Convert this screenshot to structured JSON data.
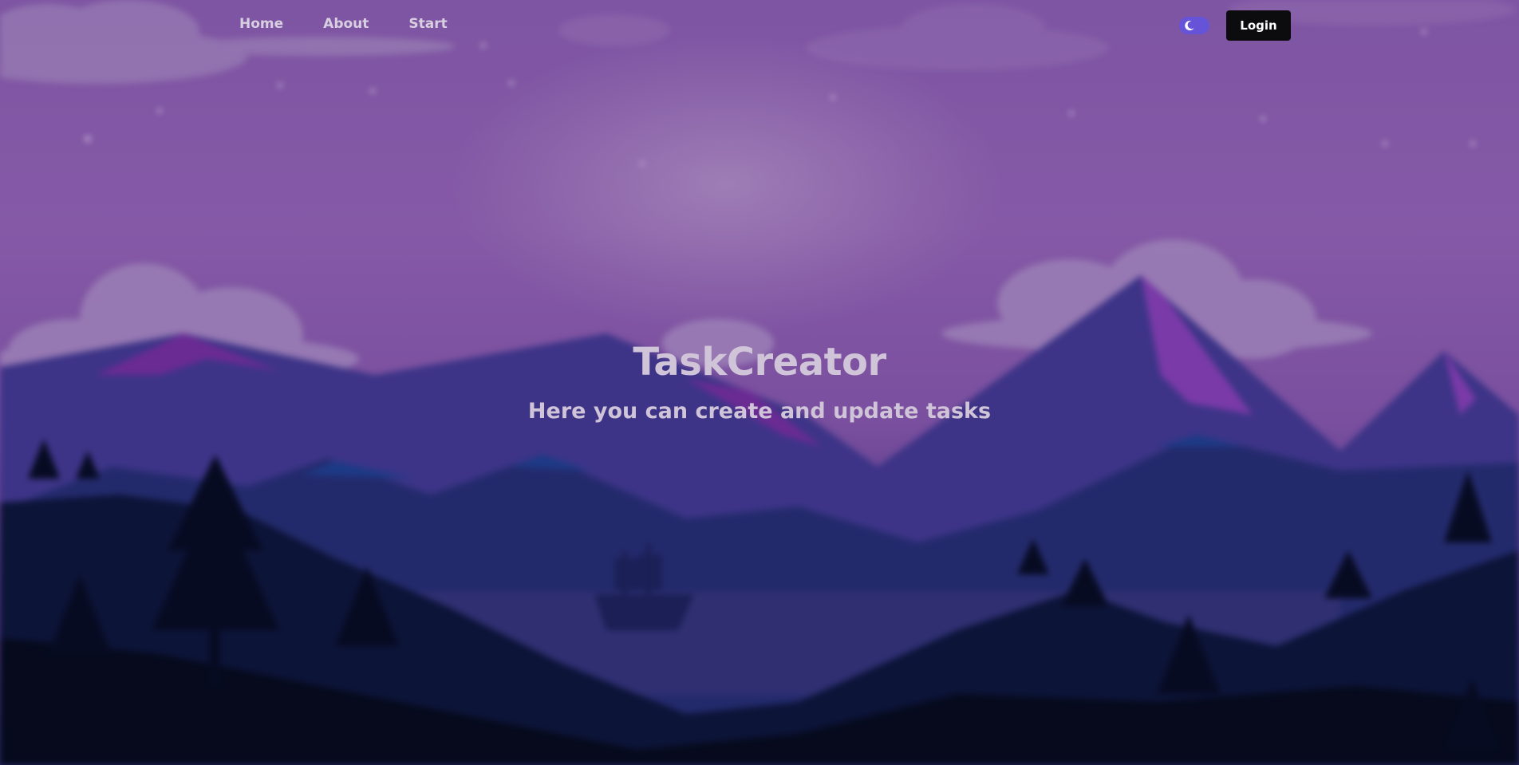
{
  "nav": {
    "links": [
      "Home",
      "About",
      "Start"
    ],
    "login_label": "Login",
    "theme_toggle_icon": "moon-icon"
  },
  "hero": {
    "title": "TaskCreator",
    "subtitle": "Here you can create and update tasks"
  },
  "colors": {
    "sky_top": "#7e55a3",
    "toggle": "#6654d8",
    "login_bg": "#0c0c0f",
    "text": "#d0c4d8"
  }
}
